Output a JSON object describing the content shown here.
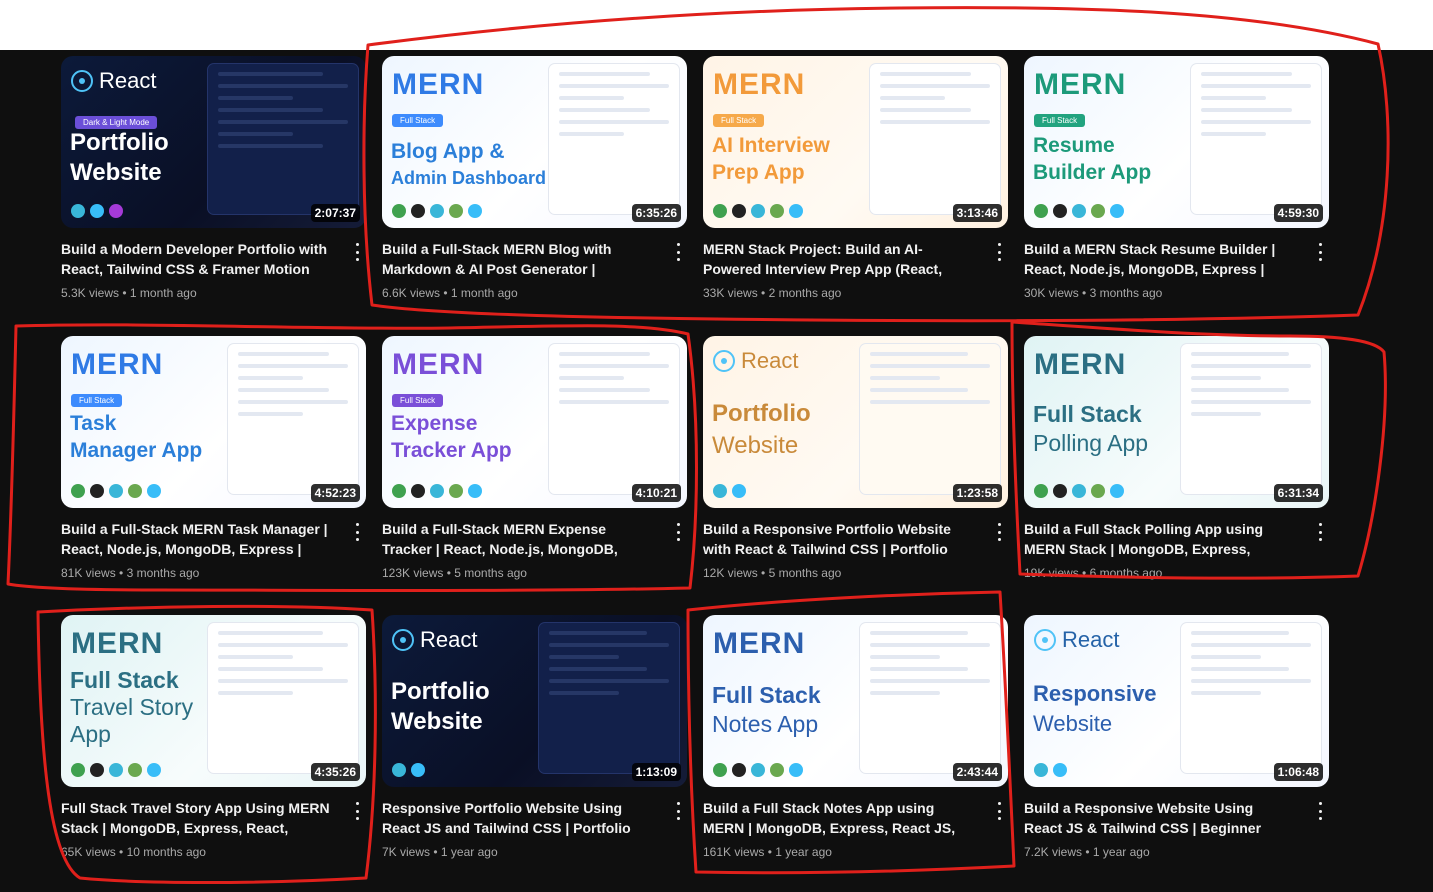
{
  "videos": [
    {
      "brand": "React",
      "title_lines": [
        "Portfolio",
        "Website"
      ],
      "pill": "Dark & Light Mode",
      "duration": "2:07:37",
      "title": "Build a Modern Developer Portfolio with React, Tailwind CSS & Framer Motion",
      "views": "5.3K views",
      "age": "1 month ago"
    },
    {
      "brand": "MERN",
      "title_lines": [
        "Blog App &",
        "Admin Dashboard"
      ],
      "pill": "Full Stack",
      "duration": "6:35:26",
      "title": "Build a Full-Stack MERN Blog with Markdown & AI Post Generator | React,…",
      "views": "6.6K views",
      "age": "1 month ago"
    },
    {
      "brand": "MERN",
      "title_lines": [
        "AI Interview",
        "Prep App"
      ],
      "pill": "Full Stack",
      "duration": "3:13:46",
      "title": "MERN Stack Project: Build an AI-Powered Interview Prep App (React, Node.js,…",
      "views": "33K views",
      "age": "2 months ago"
    },
    {
      "brand": "MERN",
      "title_lines": [
        "Resume",
        "Builder App"
      ],
      "pill": "Full Stack",
      "duration": "4:59:30",
      "title": "Build a MERN Stack Resume Builder | React, Node.js, MongoDB, Express | Full-Stack…",
      "views": "30K views",
      "age": "3 months ago"
    },
    {
      "brand": "MERN",
      "title_lines": [
        "Task",
        "Manager App"
      ],
      "pill": "Full Stack",
      "duration": "4:52:23",
      "title": "Build a Full-Stack MERN Task Manager | React, Node.js, MongoDB, Express | MERN…",
      "views": "81K views",
      "age": "3 months ago"
    },
    {
      "brand": "MERN",
      "title_lines": [
        "Expense",
        "Tracker App"
      ],
      "pill": "Full Stack",
      "duration": "4:10:21",
      "title": "Build a Full-Stack MERN Expense Tracker | React, Node.js, MongoDB, Express | MERN…",
      "views": "123K views",
      "age": "5 months ago"
    },
    {
      "brand": "React",
      "title_lines": [
        "Portfolio",
        "Website"
      ],
      "pill": "",
      "duration": "1:23:58",
      "title": "Build a Responsive Portfolio Website with React & Tailwind CSS | Portfolio Website in…",
      "views": "12K views",
      "age": "5 months ago"
    },
    {
      "brand": "MERN",
      "title_lines": [
        "Full Stack",
        "Polling App"
      ],
      "pill": "",
      "duration": "6:31:34",
      "title": "Build a Full Stack Polling App using MERN Stack | MongoDB, Express, React, Node.js |…",
      "views": "19K views",
      "age": "6 months ago"
    },
    {
      "brand": "MERN",
      "title_lines": [
        "Full Stack",
        "Travel Story",
        "App"
      ],
      "pill": "",
      "duration": "4:35:26",
      "title": "Full Stack Travel Story App Using MERN Stack | MongoDB, Express, React, Node.js |…",
      "views": "65K views",
      "age": "10 months ago"
    },
    {
      "brand": "React",
      "title_lines": [
        "Portfolio",
        "Website"
      ],
      "pill": "",
      "duration": "1:13:09",
      "title": "Responsive Portfolio Website Using React JS and Tailwind CSS | Portfolio Website in…",
      "views": "7K views",
      "age": "1 year ago"
    },
    {
      "brand": "MERN",
      "title_lines": [
        "Full Stack",
        "Notes App"
      ],
      "pill": "",
      "duration": "2:43:44",
      "title": "Build a Full Stack Notes App using MERN | MongoDB, Express, React JS, Node JS",
      "views": "161K views",
      "age": "1 year ago"
    },
    {
      "brand": "React",
      "title_lines": [
        "Responsive",
        "Website"
      ],
      "pill": "",
      "duration": "1:06:48",
      "title": "Build a Responsive Website Using React JS & Tailwind CSS | Beginner React JS Project",
      "views": "7.2K views",
      "age": "1 year ago"
    }
  ],
  "colors": {
    "page_bg": "#0f0f0f",
    "annotation": "#e0201b",
    "duration_bg": "#000000",
    "title_text": "#f1f1f1",
    "meta_text": "#aaaaaa"
  }
}
